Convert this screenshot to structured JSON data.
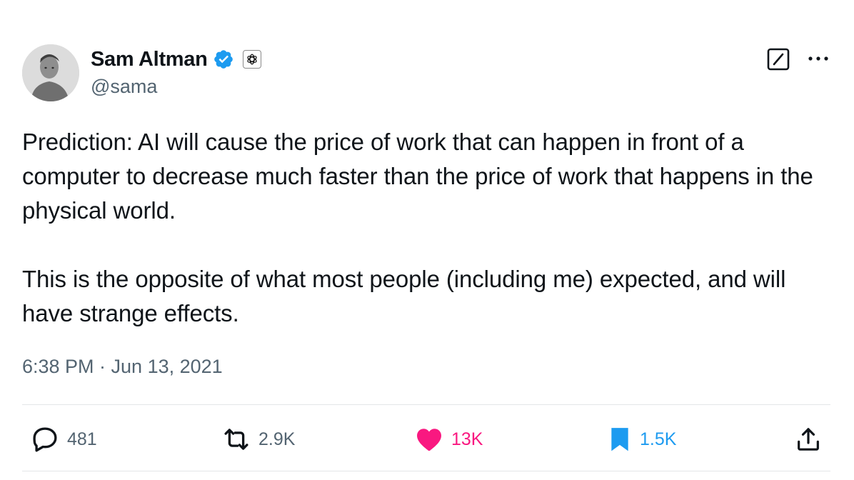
{
  "author": {
    "display_name": "Sam Altman",
    "handle": "@sama",
    "verified": true,
    "verified_color": "#1d9bf0",
    "avatar_icon": "profile-photo"
  },
  "header_icons": {
    "affiliate": "openai-logo-icon",
    "grok": "grok-icon",
    "more": "more-options-icon"
  },
  "tweet": {
    "paragraphs": [
      "Prediction: AI will cause the price of work that can happen in front of a computer to decrease much faster than the price of work that happens in the physical world.",
      "This is the opposite of what most people (including me) expected, and will have strange effects."
    ],
    "timestamp": "6:38 PM · Jun 13, 2021"
  },
  "actions": {
    "replies": "481",
    "reposts": "2.9K",
    "likes": "13K",
    "bookmarks": "1.5K"
  },
  "colors": {
    "text": "#0f1419",
    "secondary": "#536471",
    "like": "#f91880",
    "bookmark": "#1d9bf0",
    "divider": "#e3e6e8"
  }
}
